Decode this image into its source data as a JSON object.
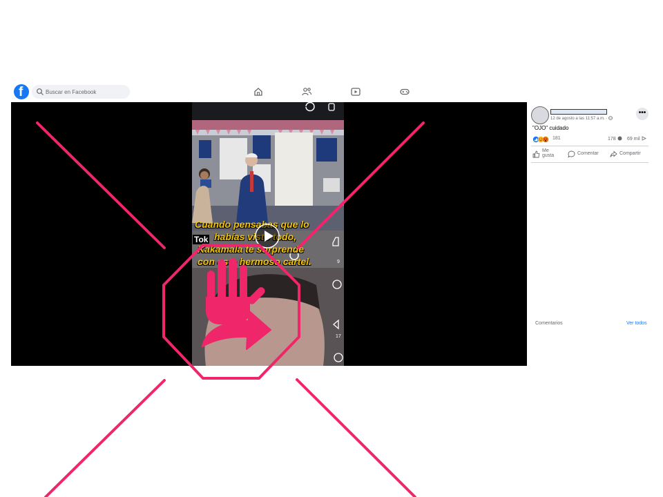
{
  "topbar": {
    "logo": "f",
    "search_placeholder": "Buscar en Facebook",
    "nav_icons": [
      "home-icon",
      "friends-icon",
      "watch-icon",
      "gaming-icon"
    ]
  },
  "video": {
    "caption_line1": "Cuando pensabas que lo",
    "caption_line2": "habías visto todo,",
    "caption_line3": "Kakamala te sorprende",
    "caption_line4": "con este hermoso cartel.",
    "tok_label": "Tok",
    "side_count_1": "9",
    "side_count_2": "17"
  },
  "post": {
    "date": "12 de agosto a las 11:57 a.m. ·",
    "text": "\"OJO\" cuidado",
    "reactions_count": "181",
    "comments_count": "178",
    "shares_count": "69 mil",
    "more_label": "•••",
    "like_label": "Me gusta",
    "comment_label": "Comentar",
    "share_label": "Compartir"
  },
  "comments": {
    "label": "Comentarios",
    "see_all": "Ver todos"
  },
  "colors": {
    "brand": "#1877f2",
    "overlay": "#f0266a"
  }
}
